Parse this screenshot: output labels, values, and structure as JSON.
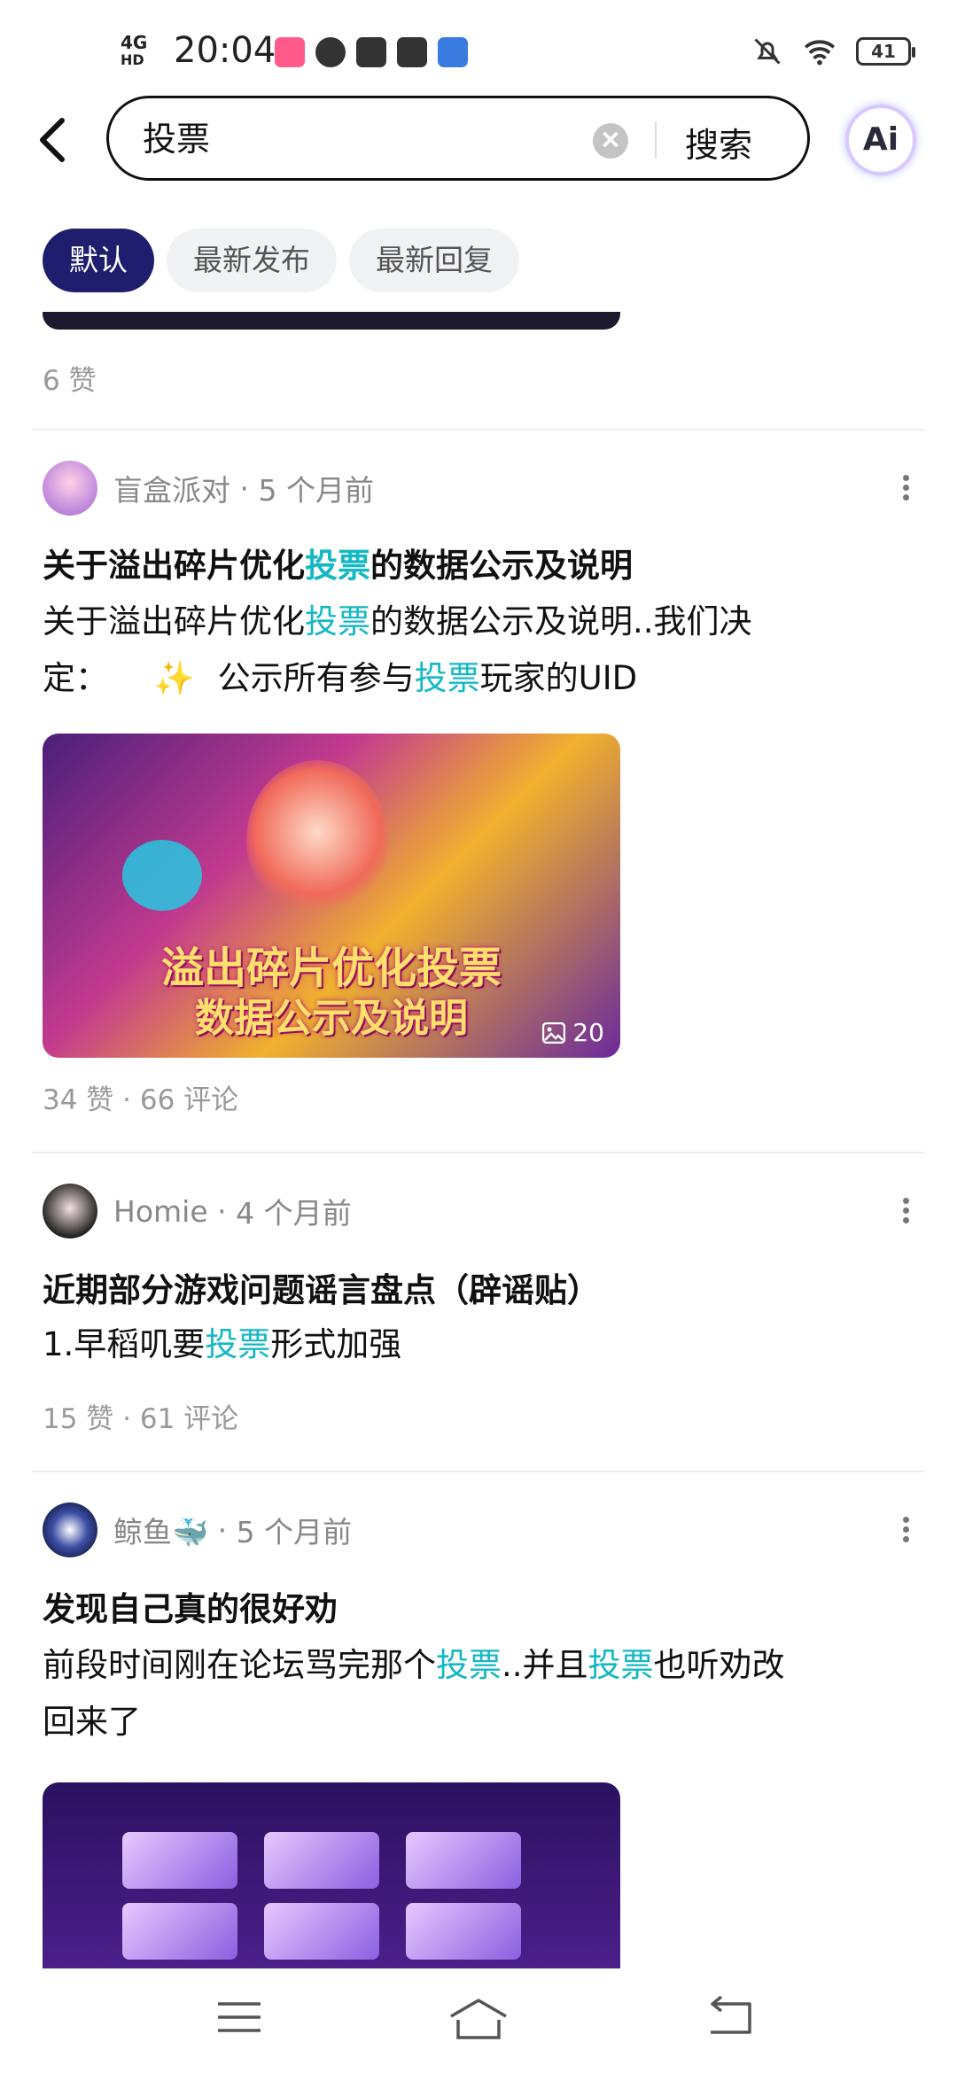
{
  "status_bar": {
    "network": "4G",
    "network_sub": "HD",
    "time": "20:04",
    "battery": "41"
  },
  "header": {
    "search_value": "投票",
    "search_button": "搜索",
    "ai_label": "Ai"
  },
  "sort_tabs": [
    {
      "label": "默认",
      "active": true
    },
    {
      "label": "最新发布",
      "active": false
    },
    {
      "label": "最新回复",
      "active": false
    }
  ],
  "feed": {
    "prev_post_stats": "6 赞",
    "posts": [
      {
        "author": "盲盒派对",
        "time": "5 个月前",
        "title_pre": "关于溢出碎片优化",
        "title_hl": "投票",
        "title_post": "的数据公示及说明",
        "body_1_pre": "关于溢出碎片优化",
        "body_1_hl": "投票",
        "body_1_post": "的数据公示及说明..我们决",
        "body_2_pre": "定：",
        "body_2_mid": "公示所有参与",
        "body_2_hl": "投票",
        "body_2_post": "玩家的UID",
        "image_line_1": "溢出碎片优化投票",
        "image_line_2": "数据公示及说明",
        "image_count": "20",
        "stats": "34 赞 · 66 评论"
      },
      {
        "author": "Homie",
        "time": "4 个月前",
        "title": "近期部分游戏问题谣言盘点（辟谣贴）",
        "body_pre": "1.早稻叽要",
        "body_hl": "投票",
        "body_post": "形式加强",
        "stats": "15 赞 · 61 评论"
      },
      {
        "author": "鲸鱼🐳",
        "time": "5 个月前",
        "title": "发现自己真的很好劝",
        "body_1_pre": "前段时间刚在论坛骂完那个",
        "body_1_hl": "投票",
        "body_1_mid": "..并且",
        "body_1_hl2": "投票",
        "body_1_post": "也听劝改",
        "body_2": "回来了"
      }
    ]
  },
  "colors": {
    "accent": "#14b8c4",
    "active_tab": "#1f1e6e"
  }
}
